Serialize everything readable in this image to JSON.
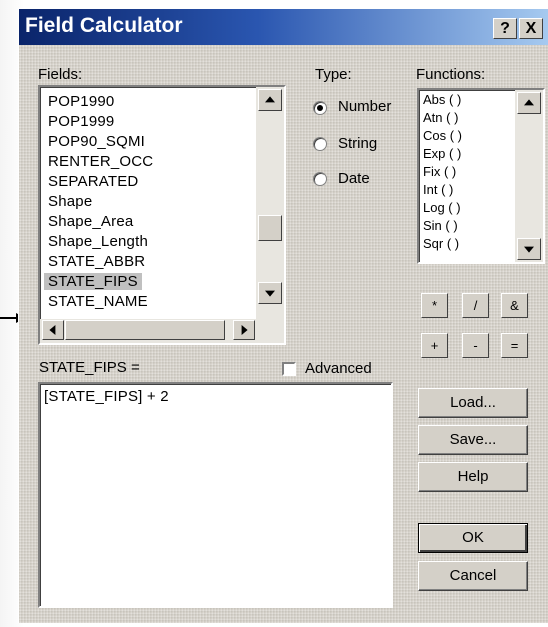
{
  "window": {
    "title": "Field Calculator",
    "help_label": "?",
    "close_label": "X"
  },
  "fields": {
    "label": "Fields:",
    "items": [
      "POP1990",
      "POP1999",
      "POP90_SQMI",
      "RENTER_OCC",
      "SEPARATED",
      "Shape",
      "Shape_Area",
      "Shape_Length",
      "STATE_ABBR",
      "STATE_FIPS",
      "STATE_NAME"
    ],
    "selected": "STATE_FIPS"
  },
  "type": {
    "label": "Type:",
    "options": [
      "Number",
      "String",
      "Date"
    ],
    "selected": "Number"
  },
  "functions": {
    "label": "Functions:",
    "items": [
      "Abs ( )",
      "Atn ( )",
      "Cos ( )",
      "Exp ( )",
      "Fix ( )",
      "Int ( )",
      "Log ( )",
      "Sin ( )",
      "Sqr ( )"
    ]
  },
  "operators": [
    "*",
    "/",
    "&",
    "+",
    "-",
    "="
  ],
  "expression": {
    "label": "STATE_FIPS =",
    "advanced_label": "Advanced",
    "advanced_checked": false,
    "value": "[STATE_FIPS] + 2"
  },
  "buttons": {
    "load": "Load...",
    "save": "Save...",
    "help": "Help",
    "ok": "OK",
    "cancel": "Cancel"
  }
}
